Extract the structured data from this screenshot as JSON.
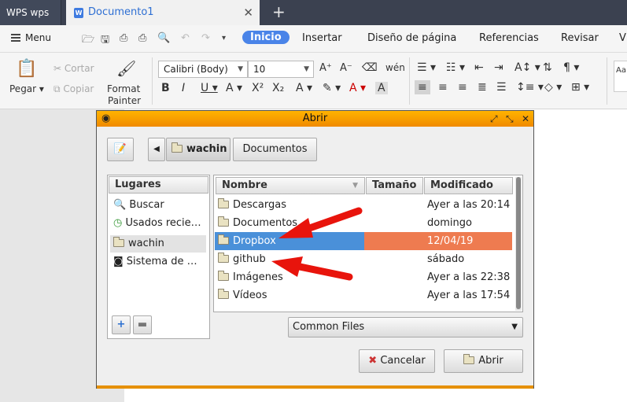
{
  "window": {
    "app_tab": "WPS wps",
    "doc_tab": "Documento1",
    "doc_icon": "W"
  },
  "menubar": {
    "menu": "Menu",
    "tabs": [
      "Inicio",
      "Insertar",
      "Diseño de página",
      "Referencias",
      "Revisar",
      "V"
    ]
  },
  "ribbon": {
    "paste": "Pegar",
    "cut": "Cortar",
    "copy": "Copiar",
    "format_painter_1": "Format",
    "format_painter_2": "Painter",
    "font": "Calibri (Body)",
    "size": "10",
    "aa_stub": "Aa"
  },
  "dialog": {
    "title": "Abrir",
    "path": [
      "wachin",
      "Documentos"
    ],
    "places_header": "Lugares",
    "places": [
      {
        "label": "Buscar",
        "icon": "search-icon"
      },
      {
        "label": "Usados recie…",
        "icon": "clock-icon"
      },
      {
        "label": "wachin",
        "icon": "folder-icon"
      },
      {
        "label": "Sistema de …",
        "icon": "drive-icon"
      }
    ],
    "columns": {
      "name": "Nombre",
      "size": "Tamaño",
      "modified": "Modificado"
    },
    "files": [
      {
        "name": "Descargas",
        "modified": "Ayer a las 20:14"
      },
      {
        "name": "Documentos",
        "modified": "domingo"
      },
      {
        "name": "Dropbox",
        "modified": "12/04/19"
      },
      {
        "name": "github",
        "modified": "sábado"
      },
      {
        "name": "Imágenes",
        "modified": "Ayer a las 22:38"
      },
      {
        "name": "Vídeos",
        "modified": "Ayer a las 17:54"
      }
    ],
    "filter": "Common Files",
    "cancel": "Cancelar",
    "open": "Abrir"
  },
  "colors": {
    "selected_name": "#4a90d9",
    "selected_modified": "#ee7b50",
    "titlebar": "#f08a00",
    "arrow": "#e8140c"
  }
}
